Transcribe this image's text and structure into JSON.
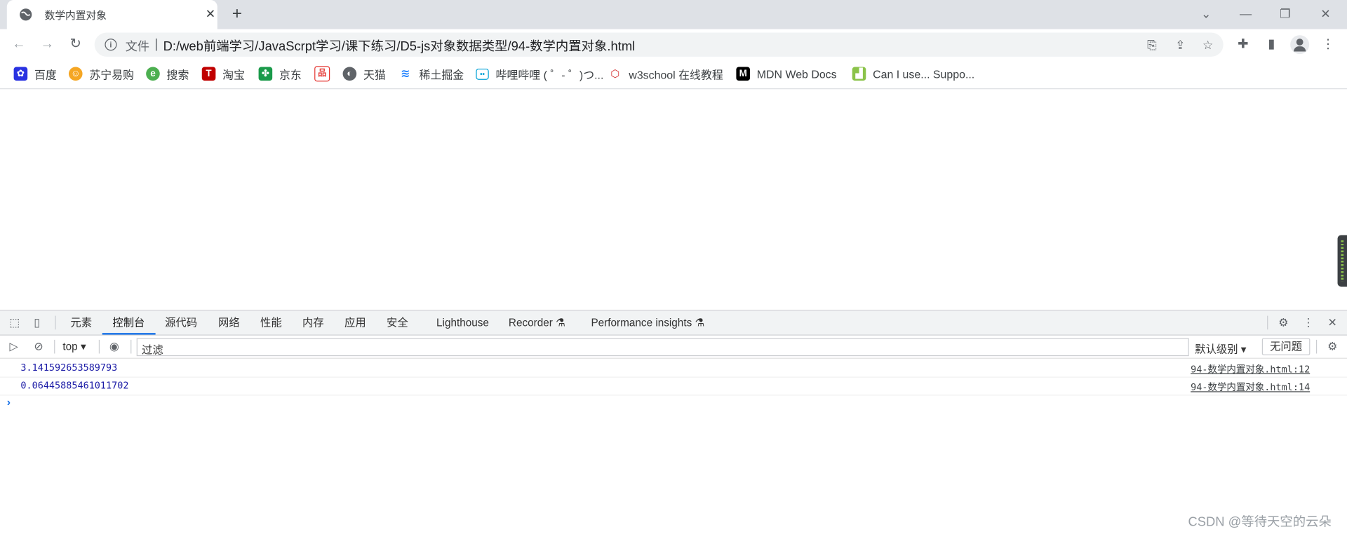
{
  "browser": {
    "tab_title": "数学内置对象",
    "tab_close": "✕",
    "new_tab": "+",
    "scheme_label": "文件",
    "separator": "|",
    "url": "D:/web前端学习/JavaScrpt学习/课下练习/D5-js对象数据类型/94-数学内置对象.html"
  },
  "bookmarks": [
    {
      "label": "百度",
      "icon": "baidu-icon",
      "color": "#2932e1"
    },
    {
      "label": "苏宁易购",
      "icon": "suning-icon",
      "color": "#f5a623"
    },
    {
      "label": "搜索",
      "icon": "search-e-icon",
      "color": "#4caf50"
    },
    {
      "label": "淘宝",
      "icon": "taobao-icon",
      "color": "#c00000"
    },
    {
      "label": "京东",
      "icon": "jd-icon",
      "color": "#1a9a4a"
    },
    {
      "label": "",
      "icon": "grid-icon",
      "color": "#e53935"
    },
    {
      "label": "天猫",
      "icon": "tmall-icon",
      "color": "#5f6368"
    },
    {
      "label": "稀土掘金",
      "icon": "juejin-icon",
      "color": "#1e80ff"
    },
    {
      "label": "哔哩哔哩 ( ゜- ゜)つ...",
      "icon": "bilibili-icon",
      "color": "#00a1d6"
    },
    {
      "label": "w3school 在线教程",
      "icon": "w3school-icon",
      "color": "#d32f2f"
    },
    {
      "label": "MDN Web Docs",
      "icon": "mdn-icon",
      "color": "#000000"
    },
    {
      "label": "Can I use... Suppo...",
      "icon": "caniuse-icon",
      "color": "#8bc34a"
    }
  ],
  "devtools": {
    "tabs": [
      "元素",
      "控制台",
      "源代码",
      "网络",
      "性能",
      "内存",
      "应用",
      "安全",
      "Lighthouse",
      "Recorder",
      "Performance insights"
    ],
    "active_tab": "控制台",
    "context": "top",
    "filter_placeholder": "过滤",
    "levels": "默认级别",
    "issues": "无问题",
    "logs": [
      {
        "value": "3.141592653589793",
        "source": "94-数学内置对象.html:12"
      },
      {
        "value": "0.06445885461011702",
        "source": "94-数学内置对象.html:14"
      }
    ],
    "prompt": "›"
  },
  "watermark": "CSDN @等待天空的云朵",
  "colors": {
    "accent": "#1a73e8",
    "log_value": "#1a1aa6"
  }
}
